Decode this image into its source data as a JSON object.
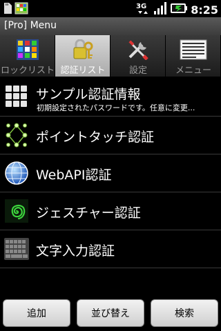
{
  "status_bar": {
    "time": "8:25",
    "network": "3G"
  },
  "title_bar": {
    "title": "[Pro] Menu"
  },
  "tabs": [
    {
      "label": "ロックリスト",
      "icon": "grid-lock-icon",
      "active": false
    },
    {
      "label": "認証リスト",
      "icon": "lock-key-icon",
      "active": true
    },
    {
      "label": "設定",
      "icon": "tools-icon",
      "active": false
    },
    {
      "label": "メニュー",
      "icon": "menu-list-icon",
      "active": false
    }
  ],
  "auth_list": [
    {
      "title": "サンプル認証情報",
      "subtitle": "初期設定されたパスワードです。任意に変更...",
      "icon": "keypad-icon"
    },
    {
      "title": "ポイントタッチ認証",
      "subtitle": "",
      "icon": "point-touch-icon"
    },
    {
      "title": "WebAPI認証",
      "subtitle": "",
      "icon": "globe-icon"
    },
    {
      "title": "ジェスチャー認証",
      "subtitle": "",
      "icon": "spiral-icon"
    },
    {
      "title": "文字入力認証",
      "subtitle": "",
      "icon": "keyboard-icon"
    }
  ],
  "bottom_buttons": {
    "add": "追加",
    "sort": "並び替え",
    "search": "検索"
  },
  "colors": {
    "active_tab": "#c0c0c0",
    "spiral": "#3cd23c",
    "globe": "#2a6fd6"
  }
}
